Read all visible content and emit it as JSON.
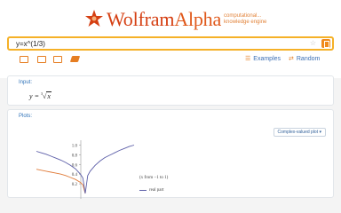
{
  "logo": {
    "brand_main": "Wolfram",
    "brand_alpha": "Alpha",
    "tagline": "computational... knowledge engine"
  },
  "search": {
    "query": "y=x^(1/3)"
  },
  "toolbar": {
    "icons": [
      "keyboard-icon",
      "image-upload-icon",
      "file-upload-icon",
      "extended-keyboard-icon"
    ],
    "examples_label": "Examples",
    "random_label": "Random"
  },
  "input_pod": {
    "title": "Input:",
    "lhs": "y",
    "eq": "=",
    "root_index": "3",
    "radicand": "x"
  },
  "plots_pod": {
    "title": "Plots:",
    "complex_select": "Complex-valued plot ▾",
    "note": "(x from −1 to 1)",
    "legend_label": "real part",
    "chart_data": {
      "type": "line",
      "yticks": [
        "1.0",
        "0.8",
        "0.6",
        "0.4",
        "0.2"
      ],
      "ylim": [
        0,
        1.1
      ],
      "xlim": [
        -1,
        1
      ],
      "series": [
        {
          "name": "real part",
          "color": "#5c5ea8",
          "x": [
            0,
            0.05,
            0.1,
            0.2,
            0.3,
            0.4,
            0.5,
            0.6,
            0.7,
            0.8,
            0.9,
            1.0
          ],
          "y": [
            0,
            0.37,
            0.46,
            0.58,
            0.67,
            0.74,
            0.79,
            0.84,
            0.89,
            0.93,
            0.97,
            1.0
          ]
        },
        {
          "color": "#e07b39",
          "x": [
            -1.0,
            -0.9,
            -0.8,
            -0.7,
            -0.6,
            -0.5,
            -0.4,
            -0.3,
            -0.2,
            -0.1,
            -0.05,
            0
          ],
          "y": [
            0.5,
            0.48,
            0.46,
            0.44,
            0.42,
            0.4,
            0.37,
            0.33,
            0.29,
            0.23,
            0.18,
            0
          ]
        },
        {
          "color": "#5c5ea8",
          "x": [
            -1.0,
            -0.9,
            -0.8,
            -0.7,
            -0.6,
            -0.5,
            -0.4,
            -0.3,
            -0.2,
            -0.1,
            -0.05,
            0
          ],
          "y": [
            0.87,
            0.84,
            0.81,
            0.77,
            0.73,
            0.69,
            0.64,
            0.58,
            0.51,
            0.4,
            0.32,
            0
          ]
        }
      ]
    }
  },
  "colors": {
    "accent": "#f08a1c",
    "link": "#3b6fb5",
    "brand": "#d53f12"
  }
}
